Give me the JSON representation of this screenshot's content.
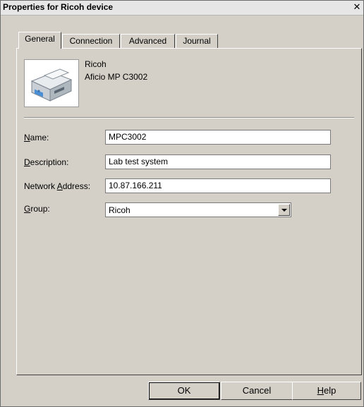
{
  "window": {
    "title": "Properties for Ricoh device",
    "close_glyph": "✕"
  },
  "tabs": [
    {
      "label": "General",
      "active": true
    },
    {
      "label": "Connection",
      "active": false
    },
    {
      "label": "Advanced",
      "active": false
    },
    {
      "label": "Journal",
      "active": false
    }
  ],
  "device": {
    "manufacturer": "Ricoh",
    "model": "Aficio MP C3002",
    "icon": "printer-icon"
  },
  "form": {
    "name": {
      "label_mnemonic": "N",
      "label_rest": "ame:",
      "value": "MPC3002"
    },
    "description": {
      "label_mnemonic": "D",
      "label_rest": "escription:",
      "value": "Lab test system"
    },
    "address": {
      "label_pre": "Network ",
      "label_mnemonic": "A",
      "label_rest": "ddress:",
      "value": "10.87.166.211"
    },
    "group": {
      "label_mnemonic": "G",
      "label_rest": "roup:",
      "value": "Ricoh"
    }
  },
  "buttons": {
    "ok": "OK",
    "cancel": "Cancel",
    "help_mnemonic": "H",
    "help_rest": "elp"
  }
}
